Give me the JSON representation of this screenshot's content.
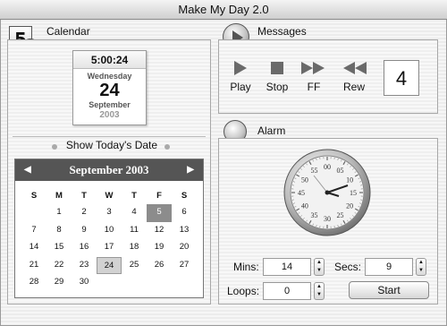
{
  "window": {
    "title": "Make My Day 2.0"
  },
  "calendar": {
    "section_title": "Calendar",
    "badge_text": "5",
    "time": "5:00:24",
    "weekday": "Wednesday",
    "day": "24",
    "month": "September",
    "year": "2003",
    "show_today_label": "Show Today's Date",
    "grid_title": "September 2003",
    "prev_arrow": "◀",
    "next_arrow": "▶",
    "days_of_week": [
      "S",
      "M",
      "T",
      "W",
      "T",
      "F",
      "S"
    ],
    "weeks": [
      [
        "",
        "1",
        "2",
        "3",
        "4",
        "5",
        "6"
      ],
      [
        "7",
        "8",
        "9",
        "10",
        "11",
        "12",
        "13"
      ],
      [
        "14",
        "15",
        "16",
        "17",
        "18",
        "19",
        "20"
      ],
      [
        "21",
        "22",
        "23",
        "24",
        "25",
        "26",
        "27"
      ],
      [
        "28",
        "29",
        "30",
        "",
        "",
        "",
        ""
      ]
    ],
    "highlight_dark": "5",
    "highlight_light": "24"
  },
  "messages": {
    "section_title": "Messages",
    "controls": [
      {
        "label": "Play",
        "icon": "play-icon"
      },
      {
        "label": "Stop",
        "icon": "stop-icon"
      },
      {
        "label": "FF",
        "icon": "fast-forward-icon"
      },
      {
        "label": "Rew",
        "icon": "rewind-icon"
      }
    ],
    "count": "4"
  },
  "alarm": {
    "section_title": "Alarm",
    "dial_numbers": [
      "00",
      "05",
      "10",
      "15",
      "20",
      "25",
      "30",
      "35",
      "40",
      "45",
      "50",
      "55"
    ],
    "mins_label": "Mins:",
    "mins_value": "14",
    "secs_label": "Secs:",
    "secs_value": "9",
    "loops_label": "Loops:",
    "loops_value": "0",
    "start_label": "Start"
  },
  "colors": {
    "accent": "#555555",
    "highlight_dark": "#8c8c8c",
    "highlight_light": "#d2d2d2"
  }
}
